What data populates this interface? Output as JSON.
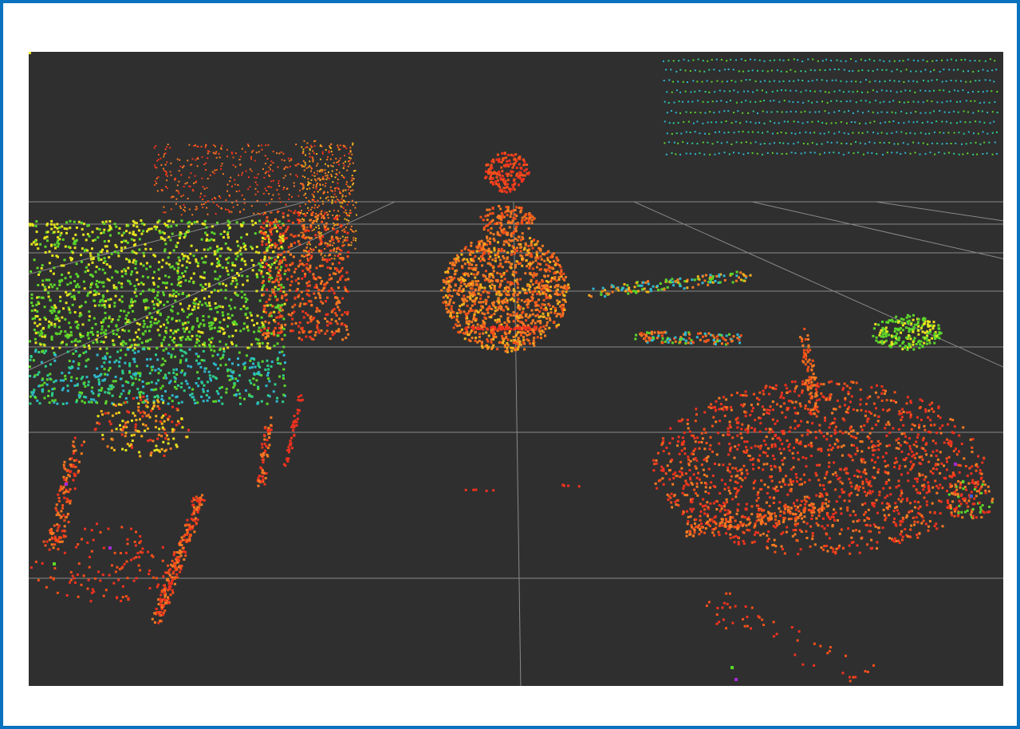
{
  "scene": {
    "background_color": "#2f2f2f",
    "frame_color": "#0a72bf",
    "grid_color": "#8a8a8a",
    "palette": {
      "red": "#f0321e",
      "red_orange": "#f5501a",
      "orange": "#f87a22",
      "yellow_orange": "#f6b21c",
      "yellow": "#e6e41e",
      "green": "#5cd62a",
      "cyan_green": "#2ccf8a",
      "cyan": "#2eb8d0",
      "blue": "#3b5bd8",
      "magenta": "#a62ad6"
    },
    "objects": [
      {
        "name": "seated-person-point-cloud",
        "colors": [
          "orange",
          "red_orange",
          "red"
        ]
      },
      {
        "name": "left-furniture-point-cloud",
        "colors": [
          "yellow",
          "green",
          "cyan_green",
          "orange",
          "red"
        ]
      },
      {
        "name": "right-furniture-point-cloud",
        "colors": [
          "red",
          "red_orange",
          "orange"
        ]
      },
      {
        "name": "back-wall-point-cloud",
        "colors": [
          "cyan",
          "cyan_green",
          "green"
        ]
      }
    ]
  }
}
